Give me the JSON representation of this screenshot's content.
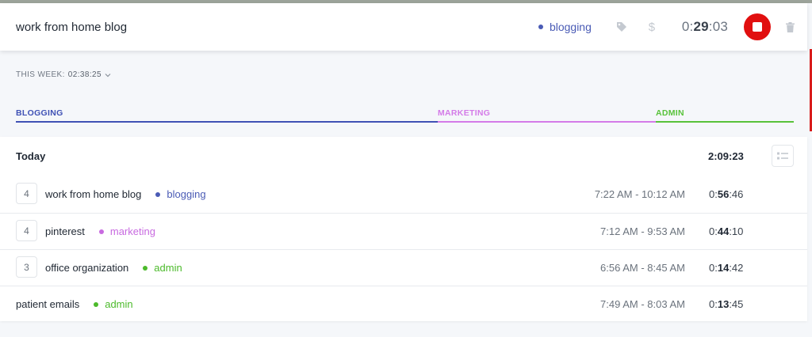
{
  "tracker": {
    "description": "work from home blog",
    "project": "blogging",
    "project_color": "#4a5bb5",
    "time_prefix": "0:",
    "time_bold": "29",
    "time_suffix": ":03"
  },
  "summary": {
    "week_label": "THIS WEEK:",
    "week_total": "02:38:25"
  },
  "projects_bar": [
    {
      "name": "BLOGGING",
      "color": "#3f51b5",
      "share": 0.542
    },
    {
      "name": "MARKETING",
      "color": "#d47be8",
      "share": 0.28
    },
    {
      "name": "ADMIN",
      "color": "#58c23a",
      "share": 0.178
    }
  ],
  "today": {
    "label": "Today",
    "total": "2:09:23"
  },
  "entries": [
    {
      "count": "4",
      "description": "work from home blog",
      "project": "blogging",
      "project_color": "#4a5bb5",
      "range": "7:22 AM - 10:12 AM",
      "dur_prefix": "0:",
      "dur_bold": "56",
      "dur_suffix": ":46"
    },
    {
      "count": "4",
      "description": "pinterest",
      "project": "marketing",
      "project_color": "#c86ae0",
      "range": "7:12 AM - 9:53 AM",
      "dur_prefix": "0:",
      "dur_bold": "44",
      "dur_suffix": ":10"
    },
    {
      "count": "3",
      "description": "office organization",
      "project": "admin",
      "project_color": "#4cba2b",
      "range": "6:56 AM - 8:45 AM",
      "dur_prefix": "0:",
      "dur_bold": "14",
      "dur_suffix": ":42"
    },
    {
      "count": "",
      "description": "patient emails",
      "project": "admin",
      "project_color": "#4cba2b",
      "range": "7:49 AM - 8:03 AM",
      "dur_prefix": "0:",
      "dur_bold": "13",
      "dur_suffix": ":45"
    }
  ],
  "icons": {
    "tag": "tag-icon",
    "billable": "dollar-icon",
    "stop": "stop-icon",
    "delete": "trash-icon",
    "list": "list-view-icon",
    "chevron": "chevron-down-icon"
  }
}
